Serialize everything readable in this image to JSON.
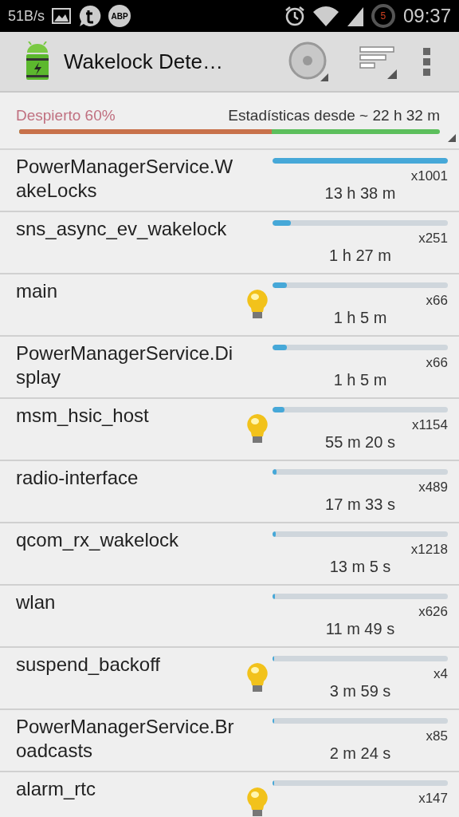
{
  "status_bar": {
    "speed": "51B/s",
    "adblock_badge": "ABP",
    "ring_badge": "5",
    "time": "09:37"
  },
  "action_bar": {
    "title": "Wakelock Dete…"
  },
  "summary": {
    "awake_label": "Despierto 60%",
    "since": "Estadísticas desde ~ 22 h 32 m",
    "level": 0.6
  },
  "wakelocks": [
    {
      "name": "PowerManagerService.WakeLocks",
      "bulb": false,
      "level": 1.0,
      "count": "x1001",
      "time": "13 h 38 m"
    },
    {
      "name": "sns_async_ev_wakelock",
      "bulb": false,
      "level": 0.106,
      "count": "x251",
      "time": "1 h 27 m"
    },
    {
      "name": "main",
      "bulb": true,
      "level": 0.08,
      "count": "x66",
      "time": "1 h 5 m"
    },
    {
      "name": "PowerManagerService.Display",
      "bulb": false,
      "level": 0.08,
      "count": "x66",
      "time": "1 h 5 m"
    },
    {
      "name": "msm_hsic_host",
      "bulb": true,
      "level": 0.068,
      "count": "x1154",
      "time": "55 m 20 s"
    },
    {
      "name": "radio-interface",
      "bulb": false,
      "level": 0.021,
      "count": "x489",
      "time": "17 m 33 s"
    },
    {
      "name": "qcom_rx_wakelock",
      "bulb": false,
      "level": 0.016,
      "count": "x1218",
      "time": "13 m 5 s"
    },
    {
      "name": "wlan",
      "bulb": false,
      "level": 0.014,
      "count": "x626",
      "time": "11 m 49 s"
    },
    {
      "name": "suspend_backoff",
      "bulb": true,
      "level": 0.005,
      "count": "x4",
      "time": "3 m 59 s"
    },
    {
      "name": "PowerManagerService.Broadcasts",
      "bulb": false,
      "level": 0.003,
      "count": "x85",
      "time": "2 m 24 s"
    },
    {
      "name": "alarm_rtc",
      "bulb": true,
      "level": 0.0,
      "count": "x147"
    }
  ]
}
